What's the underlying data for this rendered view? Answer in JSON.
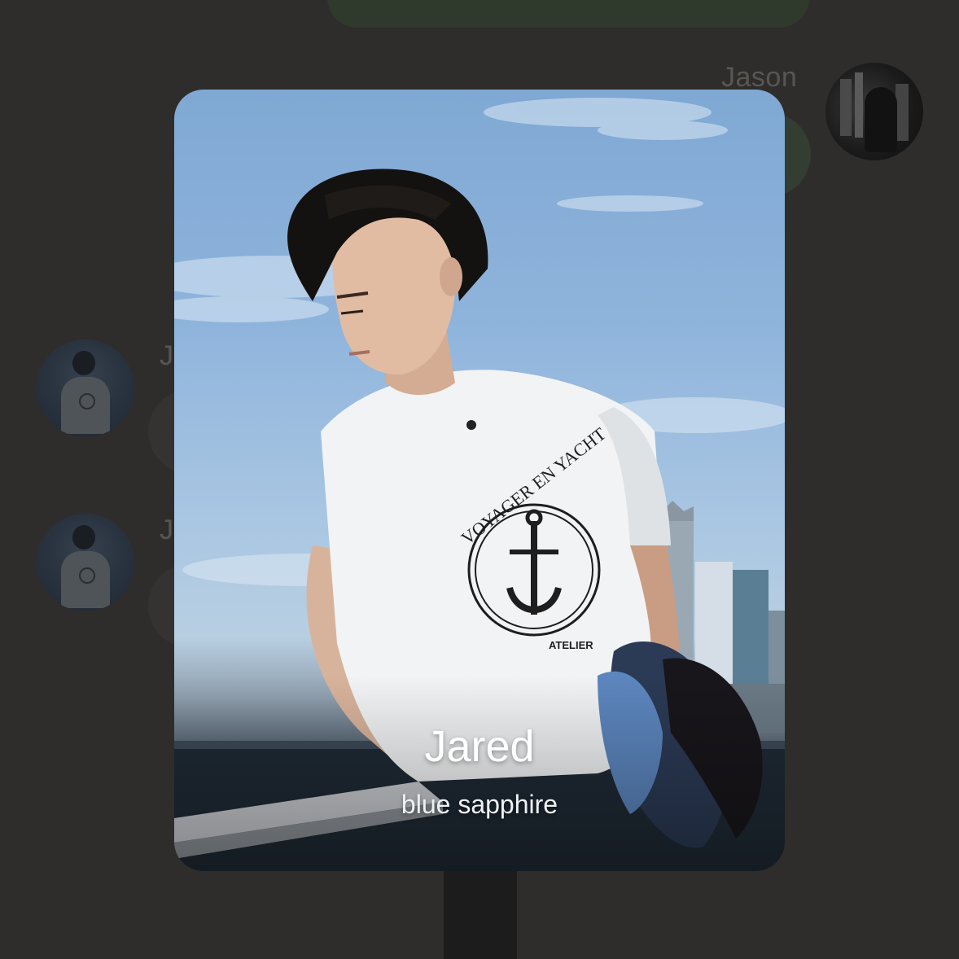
{
  "chat_background": {
    "right_sender_name": "Jason",
    "left_sender_initial_1": "J",
    "left_sender_initial_2": "J"
  },
  "profile_card": {
    "name": "Jared",
    "status": "blue sapphire",
    "photo_shirt_text_top": "VOYAGER EN YACHT",
    "photo_shirt_text_bottom": "ATELIER"
  },
  "colors": {
    "overlay_background": "#2e2d2b",
    "card_text": "#ffffff"
  },
  "icons": {
    "avatar_right": "avatar-jason",
    "avatar_left": "avatar-jared"
  }
}
